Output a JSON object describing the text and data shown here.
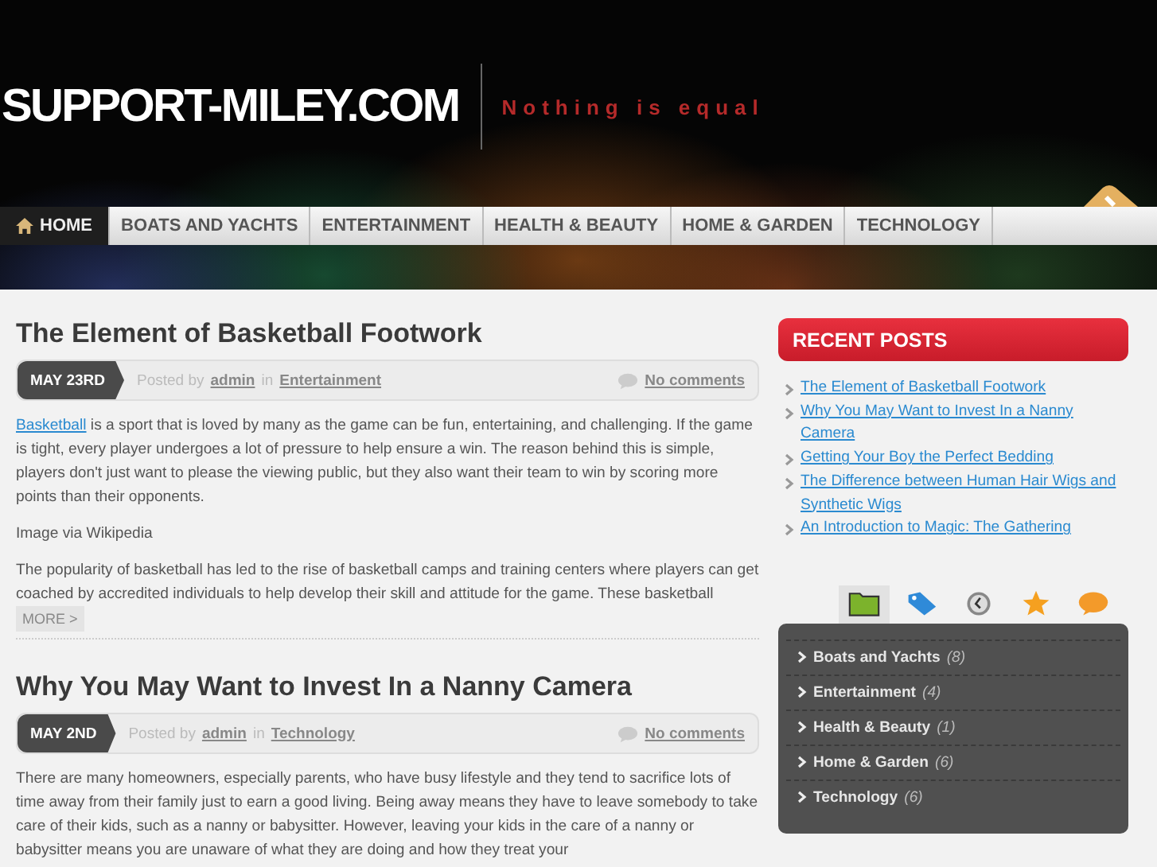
{
  "header": {
    "logo": "SUPPORT-MILEY.COM",
    "tagline": "Nothing is equal"
  },
  "nav": [
    {
      "label": "HOME",
      "selected": true,
      "kind": "home"
    },
    {
      "label": "BOATS AND YACHTS",
      "selected": false
    },
    {
      "label": "ENTERTAINMENT",
      "selected": false
    },
    {
      "label": "HEALTH & BEAUTY",
      "selected": false
    },
    {
      "label": "HOME & GARDEN",
      "selected": false
    },
    {
      "label": "TECHNOLOGY",
      "selected": false
    }
  ],
  "posts": [
    {
      "title": "The Element of Basketball Footwork",
      "date": "MAY 23RD",
      "posted_by": "Posted by",
      "author": "admin",
      "in": "in",
      "category": "Entertainment",
      "comments": "No comments",
      "paragraphs": [
        {
          "link": "Basketball",
          "text": " is a sport that is loved by many as the game can be fun, entertaining, and challenging. If the game is tight, every player undergoes a lot of pressure to help ensure a win. The reason behind this is simple, players don't just want to please the viewing public, but they also want their team to win by scoring more points than their opponents."
        },
        {
          "text": "Image via Wikipedia"
        },
        {
          "text": "The popularity of basketball has led to the rise of basketball camps and training centers where players can get coached by accredited individuals to help develop their skill and attitude for the game. These basketball",
          "more": "MORE >"
        }
      ]
    },
    {
      "title": "Why You May Want to Invest In a Nanny Camera",
      "date": "MAY 2ND",
      "posted_by": "Posted by",
      "author": "admin",
      "in": "in",
      "category": "Technology",
      "comments": "No comments",
      "paragraphs": [
        {
          "text": "There are many homeowners, especially parents, who have busy lifestyle and they tend to sacrifice lots of time away from their family just to earn a good living. Being away means they have to leave somebody to take care of their kids, such as a nanny or babysitter. However, leaving your kids in the care of a nanny or babysitter means you are unaware of what they are doing and how they treat your"
        }
      ]
    }
  ],
  "sidebar": {
    "recent_posts": {
      "title": "RECENT POSTS",
      "items": [
        "The Element of Basketball Footwork",
        "Why You May Want to Invest In a Nanny Camera",
        "Getting Your Boy the Perfect Bedding",
        "The Difference between Human Hair Wigs and Synthetic Wigs",
        "An Introduction to Magic: The Gathering"
      ]
    },
    "widget_tabs": [
      {
        "kind": "folder",
        "selected": true
      },
      {
        "kind": "tag",
        "selected": false
      },
      {
        "kind": "clock",
        "selected": false
      },
      {
        "kind": "star",
        "selected": false
      },
      {
        "kind": "chat",
        "selected": false
      }
    ],
    "categories": [
      {
        "name": "Boats and Yachts",
        "count": "(8)"
      },
      {
        "name": "Entertainment",
        "count": "(4)"
      },
      {
        "name": "Health & Beauty",
        "count": "(1)"
      },
      {
        "name": "Home & Garden",
        "count": "(6)"
      },
      {
        "name": "Technology",
        "count": "(6)"
      }
    ]
  }
}
